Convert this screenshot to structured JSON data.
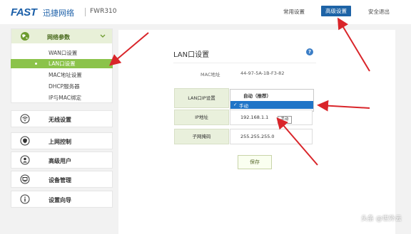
{
  "header": {
    "brand": "FAST",
    "brand_cn": "迅捷网络",
    "model": "FWR310",
    "nav": [
      {
        "label": "常用设置",
        "active": false
      },
      {
        "label": "高级设置",
        "active": true
      },
      {
        "label": "安全退出",
        "active": false
      }
    ]
  },
  "sidebar": {
    "network": {
      "label": "网络参数",
      "sub_items": [
        {
          "label": "WAN口设置",
          "active": false
        },
        {
          "label": "LAN口设置",
          "active": true
        },
        {
          "label": "MAC地址设置",
          "active": false
        },
        {
          "label": "DHCP服务器",
          "active": false
        },
        {
          "label": "IP与MAC绑定",
          "active": false
        }
      ]
    },
    "items": [
      {
        "label": "无线设置",
        "icon": "wifi-icon"
      },
      {
        "label": "上网控制",
        "icon": "shield-icon"
      },
      {
        "label": "高级用户",
        "icon": "user-icon"
      },
      {
        "label": "设备管理",
        "icon": "device-icon"
      },
      {
        "label": "设置向导",
        "icon": "info-icon"
      }
    ]
  },
  "main": {
    "title": "LAN口设置",
    "help_symbol": "?",
    "mac": {
      "label": "MAC地址",
      "value": "44-97-5A-1B-F3-82"
    },
    "lan_ip_setting": {
      "label": "LAN口IP设置",
      "selected": "自动（推荐）",
      "options": [
        "手动"
      ]
    },
    "ip": {
      "label": "IP地址",
      "value": "192.168.1.1"
    },
    "subnet": {
      "label": "子网掩码",
      "value": "255.255.255.0"
    },
    "tooltip": "手动",
    "save_label": "保存"
  },
  "watermark": "头条 @世外云"
}
